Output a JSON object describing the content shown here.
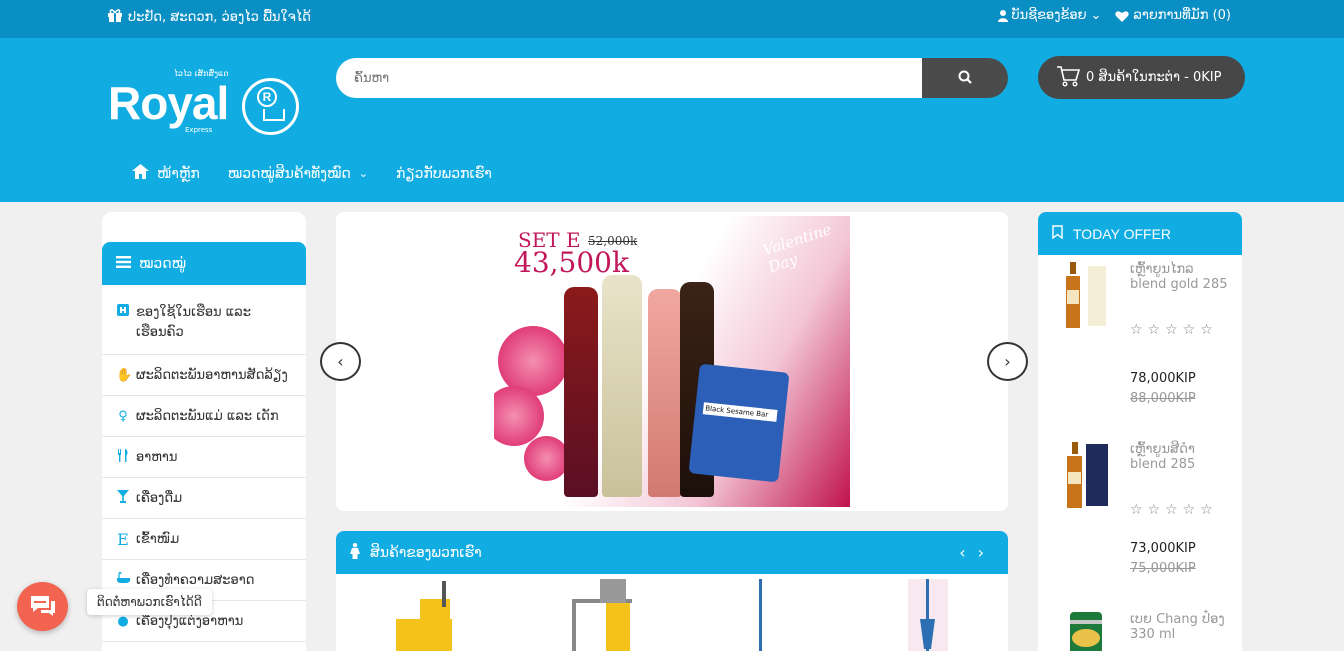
{
  "topbar": {
    "promo": "ປະຢັດ, ສະດວກ, ວ່ອງໄວ ພື້ນໃຈໄດ້",
    "account": "ບັນຊີຂອງຂ້ອຍ",
    "wishlist": "ລາຍການທີ່ມັກ (0)"
  },
  "logo": {
    "word": "Royal",
    "tag": "ໄວໄວ ເສັກສົ່ງແດ",
    "sub": "Express",
    "badge_letter": "R"
  },
  "search": {
    "placeholder": "ຄົ້ນຫາ"
  },
  "cart": {
    "label": "0 ສິນຄ້າໃນກະຕ່າ - 0KIP"
  },
  "nav": {
    "home": "ໜ້າຫຼັກ",
    "categories": "ໝວດໝູ່ສິນຄ້າທັງໝົດ",
    "about": "ກ່ຽວກັບພວກເຮົາ"
  },
  "sidebar": {
    "title": "ໝວດໝູ່",
    "items": [
      {
        "label": "ຂອງໃຊ້ໃນເຮືອນ ແລະ ເຮືອນຄົວ",
        "icon": "home-icon"
      },
      {
        "label": "ຜະລິດຕະພັນອາຫານສັດລ້ຽງ",
        "icon": "pet-icon"
      },
      {
        "label": "ຜະລິດຕະພັນແມ່ ແລະ ເດັກ",
        "icon": "baby-icon"
      },
      {
        "label": "ອາຫານ",
        "icon": "cutlery-icon"
      },
      {
        "label": "ເຄື່ອງດື່ມ",
        "icon": "glass-icon"
      },
      {
        "label": "ເຂົ້າໜົມ",
        "icon": "snack-icon"
      },
      {
        "label": "ເຄື່ອງທຳຄວາມສະອາດ",
        "icon": "bath-icon"
      },
      {
        "label": "ເຄື່ອງປຸງແຕ່ງອາຫານ",
        "icon": "spice-icon"
      }
    ]
  },
  "banner": {
    "set": "SET E",
    "old_price": "52,000k",
    "price": "43,500k",
    "tagline": "Valentine Day",
    "bag_text": "Black Sesame Bar"
  },
  "products": {
    "title": "ສິນຄ້າຂອງພວກເຮົາ"
  },
  "offer": {
    "title": "TODAY OFFER",
    "items": [
      {
        "name": "ເຫຼົ້າຍູນໄກລ blend gold 285",
        "price": "78,000KIP",
        "old_price": "88,000KIP",
        "rating": 0
      },
      {
        "name": "ເຫຼົ້າຍູນສີດຳ blend 285",
        "price": "73,000KIP",
        "old_price": "75,000KIP",
        "rating": 0
      },
      {
        "name": "ເບຍ Chang ປ໋ອງ 330 ml"
      }
    ]
  },
  "chat": {
    "tooltip": "ຕິດຕໍ່ຫາພວກເຮົາໄດ້ດີ"
  },
  "colors": {
    "primary": "#11ade2",
    "topbar": "#0a8fc4",
    "dark": "#474747",
    "chat": "#f26350"
  }
}
